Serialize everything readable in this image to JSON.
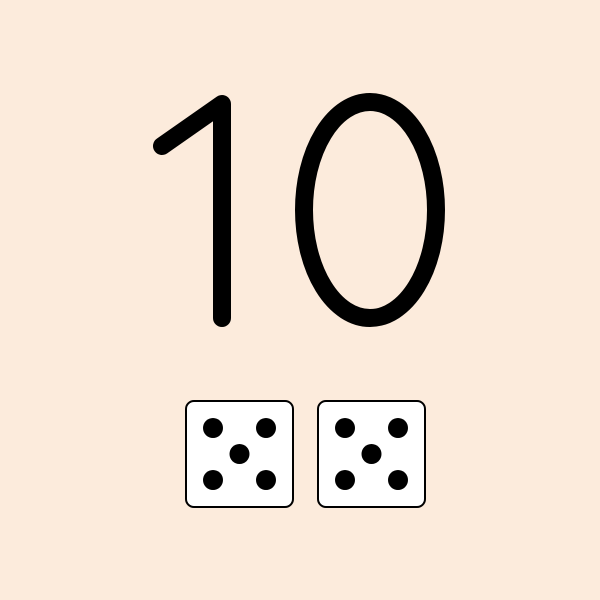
{
  "number": {
    "value": "10",
    "digits": [
      "1",
      "0"
    ]
  },
  "dice": [
    {
      "face_value": 5
    },
    {
      "face_value": 5
    }
  ],
  "colors": {
    "background": "#fcebdc",
    "ink": "#000000",
    "die_face": "#ffffff"
  }
}
